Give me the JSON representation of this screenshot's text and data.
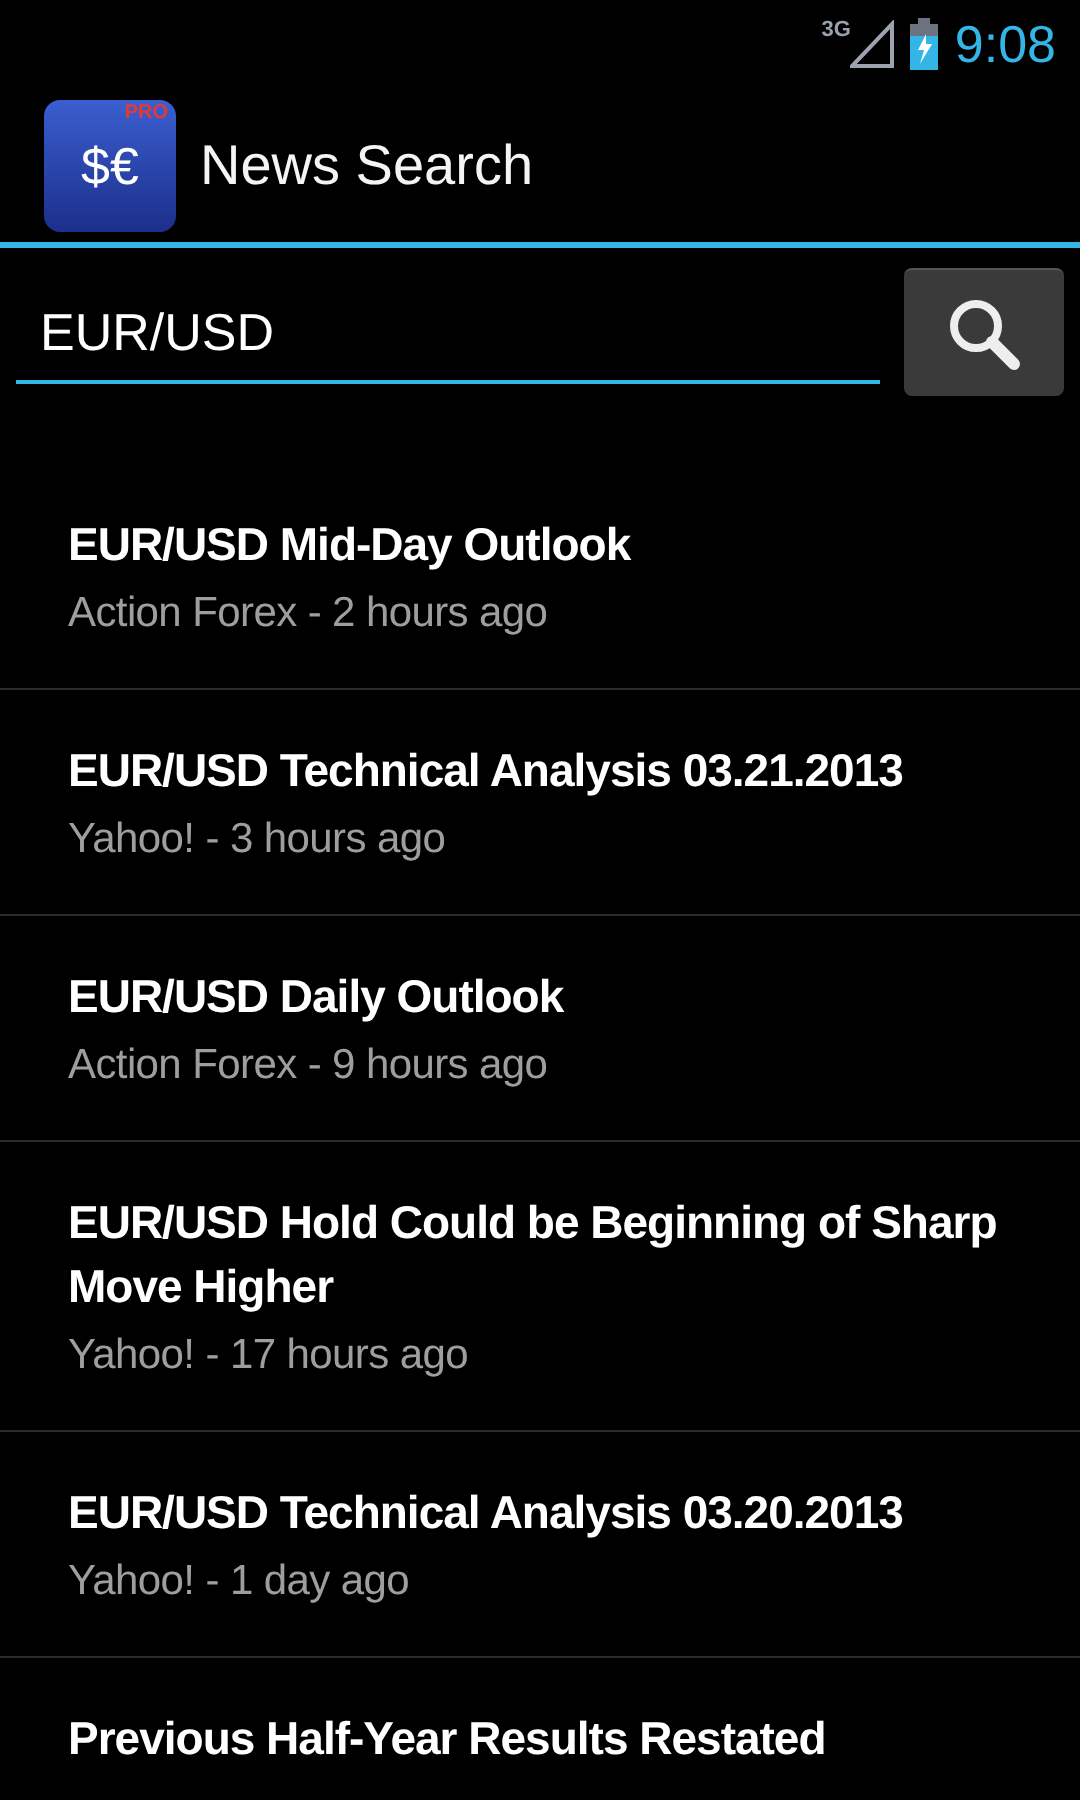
{
  "status_bar": {
    "network": "3G",
    "time": "9:08"
  },
  "action_bar": {
    "title": "News Search",
    "icon_badge": "PRO",
    "icon_symbol": "$€"
  },
  "search": {
    "value": "EUR/USD"
  },
  "news": [
    {
      "title": "EUR/USD Mid-Day Outlook",
      "source": "Action Forex - 2 hours ago"
    },
    {
      "title": "EUR/USD Technical Analysis 03.21.2013",
      "source": "Yahoo! - 3 hours ago"
    },
    {
      "title": "EUR/USD Daily Outlook",
      "source": "Action Forex - 9 hours ago"
    },
    {
      "title": "EUR/USD Hold Could be Beginning of Sharp Move Higher",
      "source": "Yahoo! - 17 hours ago"
    },
    {
      "title": "EUR/USD Technical Analysis 03.20.2013",
      "source": "Yahoo! - 1 day ago"
    },
    {
      "title": "Previous Half-Year Results Restated"
    }
  ]
}
